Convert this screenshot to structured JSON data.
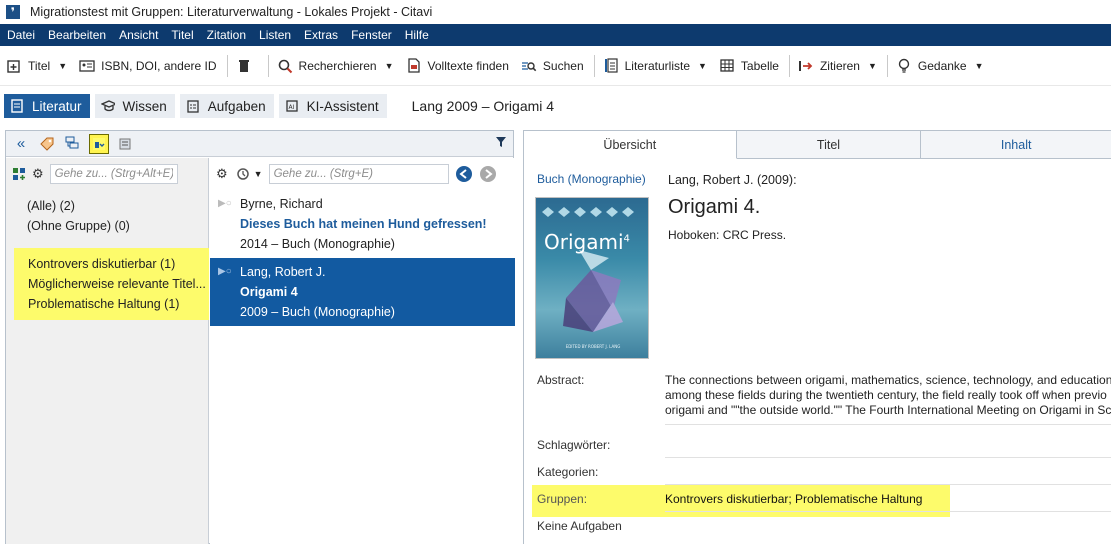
{
  "window": {
    "title": "Migrationstest mit Gruppen: Literaturverwaltung - Lokales Projekt - Citavi"
  },
  "menu": [
    "Datei",
    "Bearbeiten",
    "Ansicht",
    "Titel",
    "Zitation",
    "Listen",
    "Extras",
    "Fenster",
    "Hilfe"
  ],
  "toolbar": {
    "titel": "Titel",
    "isbn": "ISBN, DOI, andere ID",
    "recherchieren": "Recherchieren",
    "volltexte": "Volltexte finden",
    "suchen": "Suchen",
    "literaturliste": "Literaturliste",
    "tabelle": "Tabelle",
    "zitieren": "Zitieren",
    "gedanke": "Gedanke"
  },
  "nav": {
    "tabs": [
      "Literatur",
      "Wissen",
      "Aufgaben",
      "KI-Assistent"
    ],
    "current_title": "Lang 2009 – Origami 4"
  },
  "groups": {
    "search_placeholder": "Gehe zu... (Strg+Alt+E)",
    "items": [
      "(Alle) (2)",
      "(Ohne Gruppe) (0)"
    ],
    "highlighted": [
      "Kontrovers diskutierbar (1)",
      "Möglicherweise relevante Titel...",
      "Problematische Haltung (1)"
    ]
  },
  "references": {
    "search_placeholder": "Gehe zu... (Strg+E)",
    "items": [
      {
        "author": "Byrne, Richard",
        "title": "Dieses Buch hat meinen Hund gefressen!",
        "meta": "2014 – Buch (Monographie)",
        "selected": false
      },
      {
        "author": "Lang, Robert J.",
        "title": "Origami 4",
        "meta": "2009 – Buch (Monographie)",
        "selected": true
      }
    ]
  },
  "detail": {
    "tabs": [
      "Übersicht",
      "Titel",
      "Inhalt"
    ],
    "doc_type": "Buch (Monographie)",
    "author_year": "Lang, Robert J. (2009):",
    "title": "Origami 4.",
    "publisher": "Hoboken: CRC Press.",
    "cover": {
      "title": "Origami",
      "superscript": "4",
      "editor": "EDITED BY ROBERT J. LANG"
    },
    "labels": {
      "abstract": "Abstract:",
      "keywords": "Schlagwörter:",
      "categories": "Kategorien:",
      "groups": "Gruppen:",
      "tasks": "Keine Aufgaben"
    },
    "abstract_lines": [
      "The connections between origami, mathematics, science, technology, and education",
      "among these fields during the twentieth century, the field really took off when previo",
      "origami and \"\"the outside world.\"\" The Fourth International Meeting on Origami in Sc"
    ],
    "groups_value": "Kontrovers diskutierbar; Problematische Haltung"
  },
  "colors": {
    "menu_bg": "#0d3a6e",
    "accent": "#1e5c9c",
    "highlight": "#fdfb6b",
    "selection": "#125aa1"
  }
}
